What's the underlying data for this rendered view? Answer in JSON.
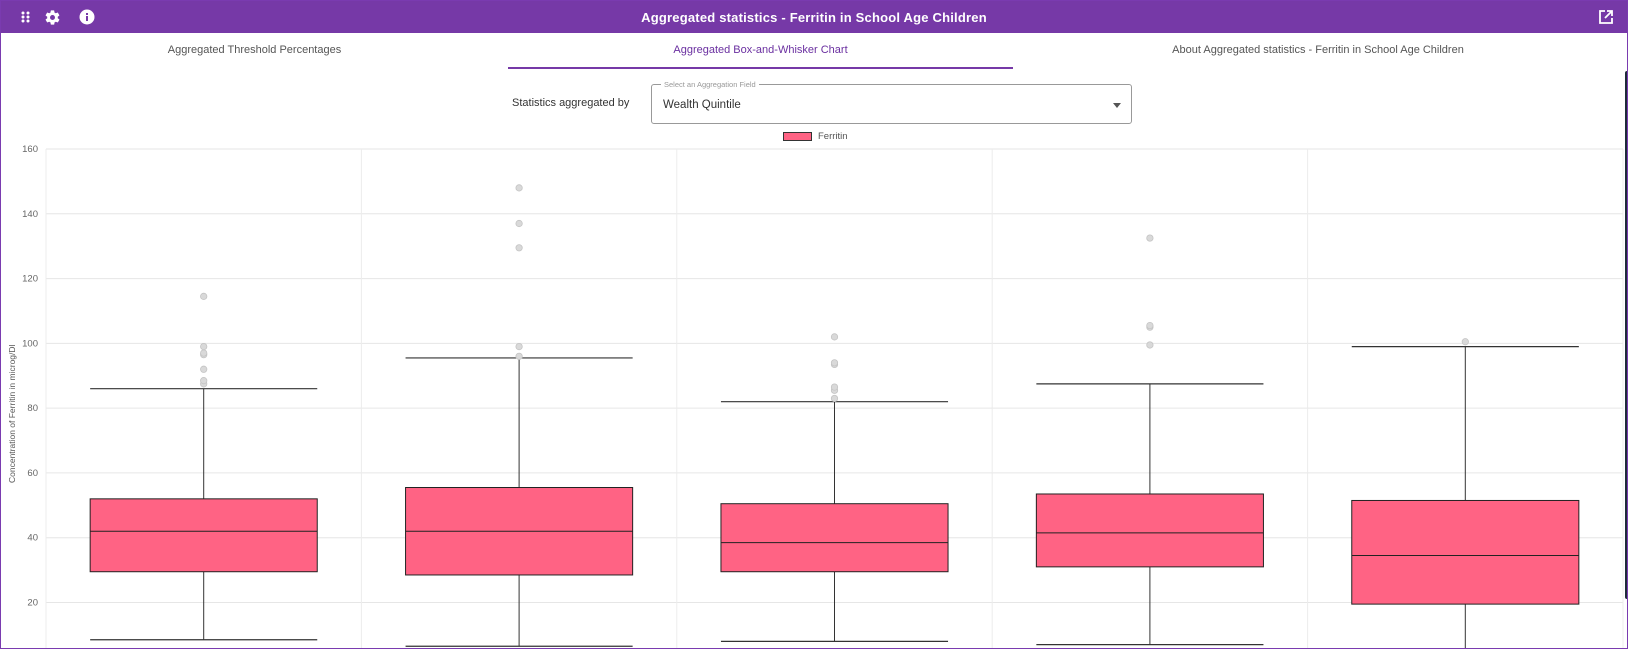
{
  "header": {
    "title": "Aggregated statistics - Ferritin in School Age Children",
    "menu_icon": "apps-grid-icon",
    "settings_icon": "gear-icon",
    "info_icon": "info-icon",
    "popout_icon": "open-in-new-icon"
  },
  "tabs": [
    {
      "label": "Aggregated Threshold Percentages",
      "active": false
    },
    {
      "label": "Aggregated Box-and-Whisker Chart",
      "active": true
    },
    {
      "label": "About Aggregated statistics - Ferritin in School Age Children",
      "active": false
    }
  ],
  "aggregation": {
    "label": "Statistics aggregated by",
    "select_legend": "Select an Aggregation Field",
    "selected_value": "Wealth Quintile"
  },
  "colors": {
    "accent": "#7639a7",
    "box_fill": "#ff6384",
    "outlier": "#cccccc"
  },
  "chart_data": {
    "type": "boxplot",
    "ylabel": "Concentration of Ferritin in microg/Dl",
    "ylim": [
      5,
      160
    ],
    "yticks": [
      20,
      40,
      60,
      80,
      100,
      120,
      140,
      160
    ],
    "grid": true,
    "legend_position": "top-center",
    "series": [
      {
        "name": "Ferritin",
        "boxes": [
          {
            "min": 8.5,
            "q1": 29.5,
            "median": 42,
            "q3": 52,
            "max": 86,
            "outliers": [
              87.5,
              88.5,
              92,
              96.5,
              97,
              99,
              114.5
            ]
          },
          {
            "min": 6.5,
            "q1": 28.5,
            "median": 42,
            "q3": 55.5,
            "max": 95.5,
            "outliers": [
              96,
              99,
              129.5,
              137,
              148
            ]
          },
          {
            "min": 8,
            "q1": 29.5,
            "median": 38.5,
            "q3": 50.5,
            "max": 82,
            "outliers": [
              83,
              85.5,
              86.5,
              93.5,
              94,
              102
            ]
          },
          {
            "min": 7,
            "q1": 31,
            "median": 41.5,
            "q3": 53.5,
            "max": 87.5,
            "outliers": [
              99.5,
              105,
              105.5,
              132.5
            ]
          },
          {
            "min": 5,
            "q1": 19.5,
            "median": 34.5,
            "q3": 51.5,
            "max": 99,
            "outliers": [
              100.5
            ]
          }
        ]
      }
    ]
  }
}
